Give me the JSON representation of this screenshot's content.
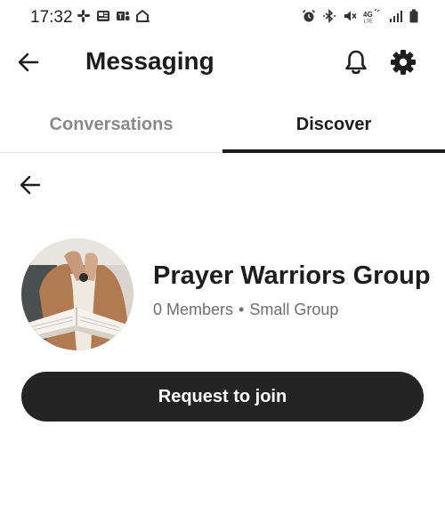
{
  "status_bar": {
    "time": "17:32",
    "left_icons": [
      "slack-icon",
      "news-icon",
      "teams-icon",
      "home-icon"
    ],
    "right_icons": [
      "alarm-icon",
      "bluetooth-icon",
      "mute-icon",
      "lte-signal-icon",
      "cell-signal-icon",
      "battery-icon"
    ],
    "network_label": "4G LTE"
  },
  "header": {
    "title": "Messaging",
    "back_icon": "back-arrow-icon",
    "notifications_icon": "bell-icon",
    "settings_icon": "gear-icon"
  },
  "tabs": [
    {
      "label": "Conversations",
      "active": false
    },
    {
      "label": "Discover",
      "active": true
    }
  ],
  "group": {
    "name": "Prayer Warriors Group",
    "members": "0 Members",
    "separator": "•",
    "type": "Small Group",
    "avatar_icon": "group-photo-avatar"
  },
  "actions": {
    "join_label": "Request to join"
  },
  "colors": {
    "primary_dark": "#242424",
    "inactive_tab": "#8a8a8a",
    "meta_text": "#6e6e6e"
  }
}
